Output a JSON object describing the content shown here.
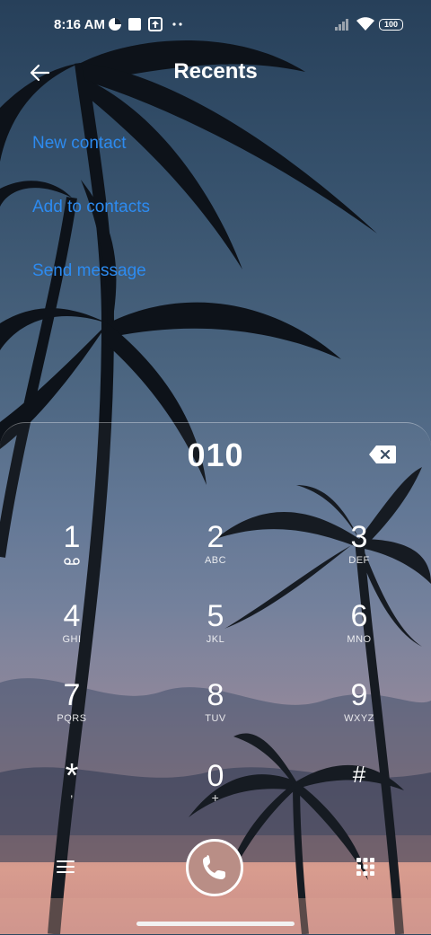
{
  "status_bar": {
    "time": "8:16 AM",
    "battery": "100",
    "icons": [
      "data-saver-icon",
      "square-notification-icon",
      "upload-notification-icon",
      "more-dots-icon",
      "signal-icon",
      "wifi-icon",
      "battery-icon"
    ]
  },
  "header": {
    "title": "Recents",
    "back_icon": "back-arrow-icon"
  },
  "actions": [
    {
      "label": "New contact"
    },
    {
      "label": "Add to contacts"
    },
    {
      "label": "Send message"
    }
  ],
  "dialer": {
    "number": "010",
    "backspace_icon": "backspace-icon",
    "keys": [
      {
        "digit": "1",
        "letters": ""
      },
      {
        "digit": "2",
        "letters": "ABC"
      },
      {
        "digit": "3",
        "letters": "DEF"
      },
      {
        "digit": "4",
        "letters": "GHI"
      },
      {
        "digit": "5",
        "letters": "JKL"
      },
      {
        "digit": "6",
        "letters": "MNO"
      },
      {
        "digit": "7",
        "letters": "PQRS"
      },
      {
        "digit": "8",
        "letters": "TUV"
      },
      {
        "digit": "9",
        "letters": "WXYZ"
      },
      {
        "digit": "*",
        "letters": ","
      },
      {
        "digit": "0",
        "letters": "+"
      },
      {
        "digit": "#",
        "letters": ""
      }
    ],
    "bottom": {
      "menu_icon": "menu-icon",
      "call_icon": "phone-icon",
      "keypad_icon": "dialpad-icon"
    }
  },
  "colors": {
    "link": "#2d8bf0",
    "call_button": "#b98e86"
  }
}
